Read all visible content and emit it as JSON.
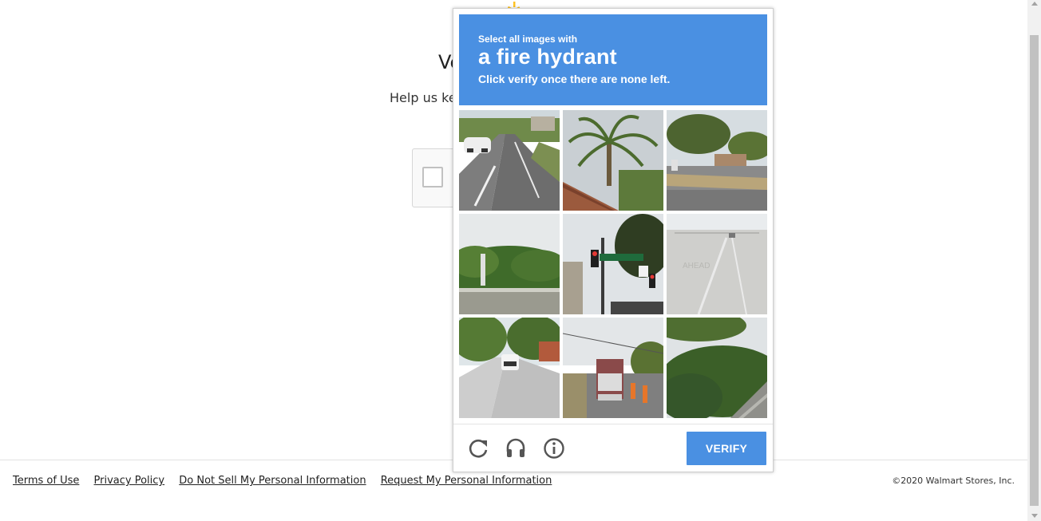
{
  "page": {
    "title_partial": "Ve",
    "subtitle_partial": "Help us kee"
  },
  "captcha": {
    "prompt_pre": "Select all images with",
    "prompt_target": "a fire hydrant",
    "prompt_post": "Click verify once there are none left.",
    "verify_label": "VERIFY",
    "tiles": [
      "street-road-car",
      "palm-tree-roof",
      "street-intersection-trees",
      "roadside-greenery",
      "traffic-lights-street-signs",
      "concrete-highway",
      "residential-street-truck",
      "road-semi-truck",
      "hedge-sidewalk"
    ],
    "icons": [
      "reload-icon",
      "audio-icon",
      "info-icon"
    ],
    "accent_color": "#4a90e2"
  },
  "footer": {
    "links": [
      "Terms of Use",
      "Privacy Policy",
      "Do Not Sell My Personal Information",
      "Request My Personal Information"
    ],
    "copyright": "©2020 Walmart Stores, Inc."
  }
}
